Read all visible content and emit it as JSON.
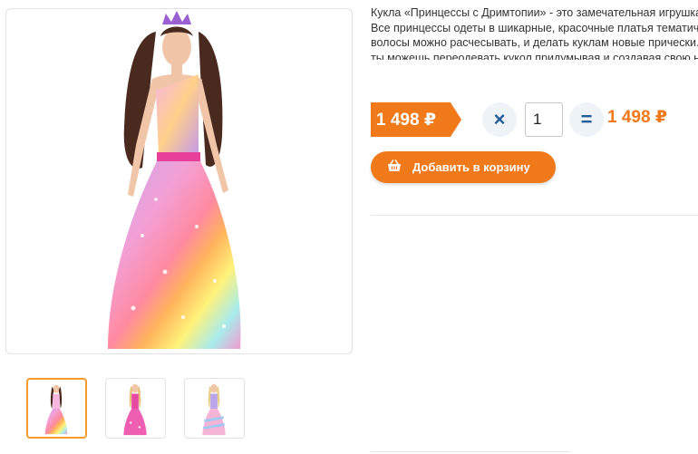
{
  "product": {
    "description_lines": [
      "Кукла  «Принцессы с Дримтопии» - это замечательная игрушка",
      "Все принцессы одеты в шикарные, красочные платья тематиче",
      "волосы можно расчесывать, и делать куклам новые прически.",
      "ты можешь переодевать кукол придумывая и создавая свою но"
    ],
    "price": "1 498 ₽",
    "quantity": "1",
    "total": "1 498 ₽",
    "multiply_symbol": "×",
    "equals_symbol": "=",
    "add_to_cart_label": "Добавить в корзину",
    "cart_icon": "basket-icon"
  },
  "gallery": {
    "main_image": "doll-rainbow-princess",
    "thumbnails": [
      {
        "name": "doll-rainbow-princess",
        "active": true
      },
      {
        "name": "doll-pink-princess",
        "active": false
      },
      {
        "name": "doll-blonde-princess",
        "active": false
      }
    ]
  },
  "colors": {
    "accent": "#f07a1a",
    "operator": "#1f5c99",
    "operator_bg": "#eef3f8"
  }
}
